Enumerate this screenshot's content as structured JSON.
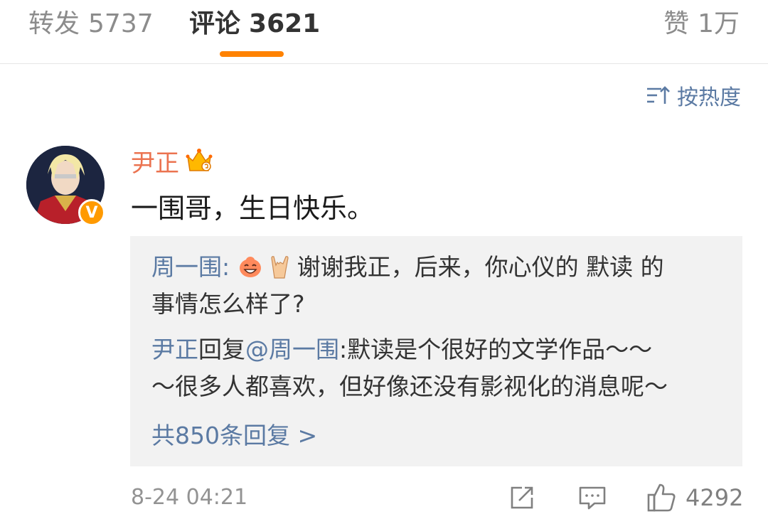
{
  "tabs": {
    "repost": {
      "label": "转发",
      "count": "5737"
    },
    "comment": {
      "label": "评论",
      "count": "3621"
    },
    "like": {
      "label": "赞",
      "count": "1万"
    }
  },
  "sort": {
    "label": "按热度",
    "icon": "sort-icon"
  },
  "comment": {
    "username": "尹正",
    "badge_icon": "crown-badge-icon",
    "verified_label": "V",
    "text": "一围哥，生日快乐。",
    "replies": [
      {
        "author": "周一围",
        "separator": ": ",
        "emojis": [
          "laughing-emoji",
          "rock-hand-emoji"
        ],
        "text_line1": "谢谢我正，后来，你心仪的 默读 的",
        "text_line2": "事情怎么样了?"
      },
      {
        "author": "尹正",
        "reply_word": "回复",
        "mention": "@周一围",
        "separator": ":",
        "text_line1": "默读是个很好的文学作品～～",
        "text_line2": "～很多人都喜欢，但好像还没有影视化的消息呢～"
      }
    ],
    "more_replies": "共850条回复 >",
    "timestamp": "8-24 04:21",
    "like_count": "4292"
  },
  "colors": {
    "accent_orange": "#ff8200",
    "username_orange": "#eb7350",
    "link_blue": "#5b7aa3",
    "reply_bg": "#f2f2f2"
  }
}
